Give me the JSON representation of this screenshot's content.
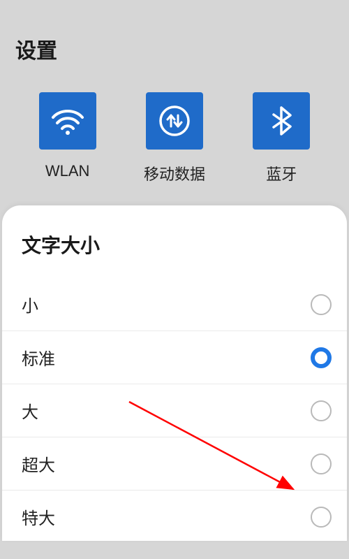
{
  "header": {
    "title": "设置"
  },
  "tiles": [
    {
      "key": "wlan",
      "label": "WLAN",
      "icon": "wifi-icon"
    },
    {
      "key": "mobiledata",
      "label": "移动数据",
      "icon": "mobile-data-icon"
    },
    {
      "key": "bluetooth",
      "label": "蓝牙",
      "icon": "bluetooth-icon"
    }
  ],
  "panel": {
    "title": "文字大小",
    "options": [
      {
        "label": "小",
        "selected": false
      },
      {
        "label": "标准",
        "selected": true
      },
      {
        "label": "大",
        "selected": false
      },
      {
        "label": "超大",
        "selected": false
      },
      {
        "label": "特大",
        "selected": false
      }
    ]
  },
  "colors": {
    "tile_bg": "#1f6bc9",
    "accent": "#1f78e6",
    "annotation_arrow": "#ff0000"
  }
}
